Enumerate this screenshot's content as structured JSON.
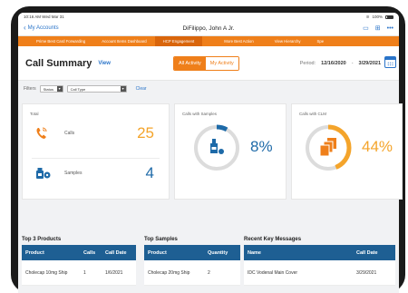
{
  "status_bar": {
    "time": "10:16 AM",
    "date": "Wed Mar 31",
    "signal": "100%"
  },
  "nav": {
    "back_label": "My Accounts",
    "title": "DiFilippo, John A Jr."
  },
  "tabs": [
    {
      "label": "Prime Best Card Forwarding"
    },
    {
      "label": "Account Items Dashboard"
    },
    {
      "label": "HCP Engagement",
      "active": true
    },
    {
      "label": "More Best Action"
    },
    {
      "label": "View Hierarchy"
    },
    {
      "label": "Spe"
    }
  ],
  "summary": {
    "title": "Call Summary",
    "view_link": "View",
    "toggle_all": "All Activity",
    "toggle_my": "My Activity",
    "period_label": "Period:",
    "period_start": "12/16/2020",
    "period_sep": "-",
    "period_end": "3/29/2021"
  },
  "filters": {
    "label": "Filters",
    "select1": "Status",
    "select2": "Call Type",
    "clear": "Clear"
  },
  "cards": {
    "total": {
      "label": "Total",
      "calls_label": "Calls",
      "calls_value": "25",
      "samples_label": "Samples",
      "samples_value": "4"
    },
    "with_samples": {
      "label": "Calls with Samples",
      "value": "8%",
      "fraction": 0.08,
      "color": "#1e6aa8"
    },
    "with_clm": {
      "label": "Calls with CLM",
      "value": "44%",
      "fraction": 0.44,
      "color": "#f4a42b"
    }
  },
  "colors": {
    "accent_orange": "#ef7f1a",
    "link_blue": "#2a74c9",
    "header_blue": "#1e5f93",
    "samples_blue": "#1e6aa8",
    "clm_orange": "#f4a42b"
  },
  "top_products": {
    "title": "Top 3 Products",
    "headers": [
      "Product",
      "Calls",
      "Call Date"
    ],
    "rows": [
      [
        "Cholecap 10mg Ship",
        "1",
        "1/6/2021"
      ]
    ]
  },
  "top_samples": {
    "title": "Top Samples",
    "headers": [
      "Product",
      "Quantity"
    ],
    "rows": [
      [
        "Cholecap 20mg Ship",
        "2"
      ]
    ]
  },
  "key_messages": {
    "title": "Recent Key Messages",
    "headers": [
      "Name",
      "Call Date"
    ],
    "rows": [
      [
        "IDC Vodenal Main Cover",
        "3/29/2021"
      ]
    ]
  }
}
